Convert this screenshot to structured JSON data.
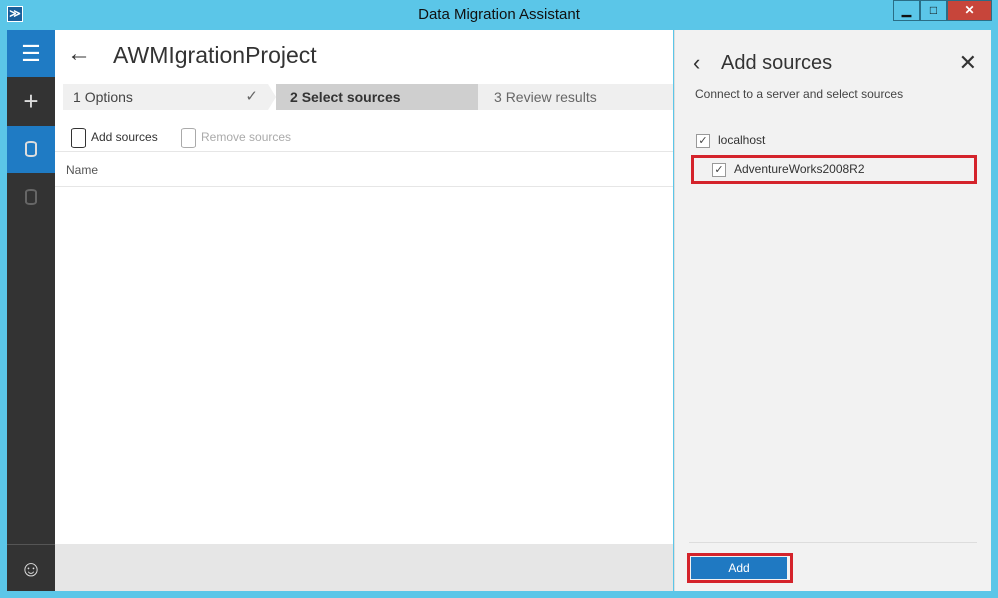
{
  "window": {
    "title": "Data Migration Assistant",
    "app_icon_glyph": "≫",
    "minimize_glyph": "▁",
    "maximize_glyph": "□",
    "close_glyph": "✕"
  },
  "rail": {
    "menu_glyph": "☰",
    "new_glyph": "+",
    "feedback_glyph": "☺",
    "accent": "#1f7bc4"
  },
  "main": {
    "back_glyph": "←",
    "project_title": "AWMIgrationProject",
    "steps": [
      {
        "number": "1",
        "label": "Options",
        "done_glyph": "✓"
      },
      {
        "number": "2",
        "label": "Select sources"
      },
      {
        "number": "3",
        "label": "Review results"
      }
    ],
    "toolbar": {
      "add_sources": "Add sources",
      "remove_sources": "Remove sources"
    },
    "column_header": "Name"
  },
  "panel": {
    "back_glyph": "‹",
    "title": "Add sources",
    "close_glyph": "✕",
    "subtitle": "Connect to a server and select sources",
    "server": {
      "label": "localhost",
      "checked": true
    },
    "database": {
      "label": "AdventureWorks2008R2",
      "checked": true
    },
    "check_glyph": "✓",
    "add_button": "Add",
    "highlight_color": "#d4232b"
  }
}
